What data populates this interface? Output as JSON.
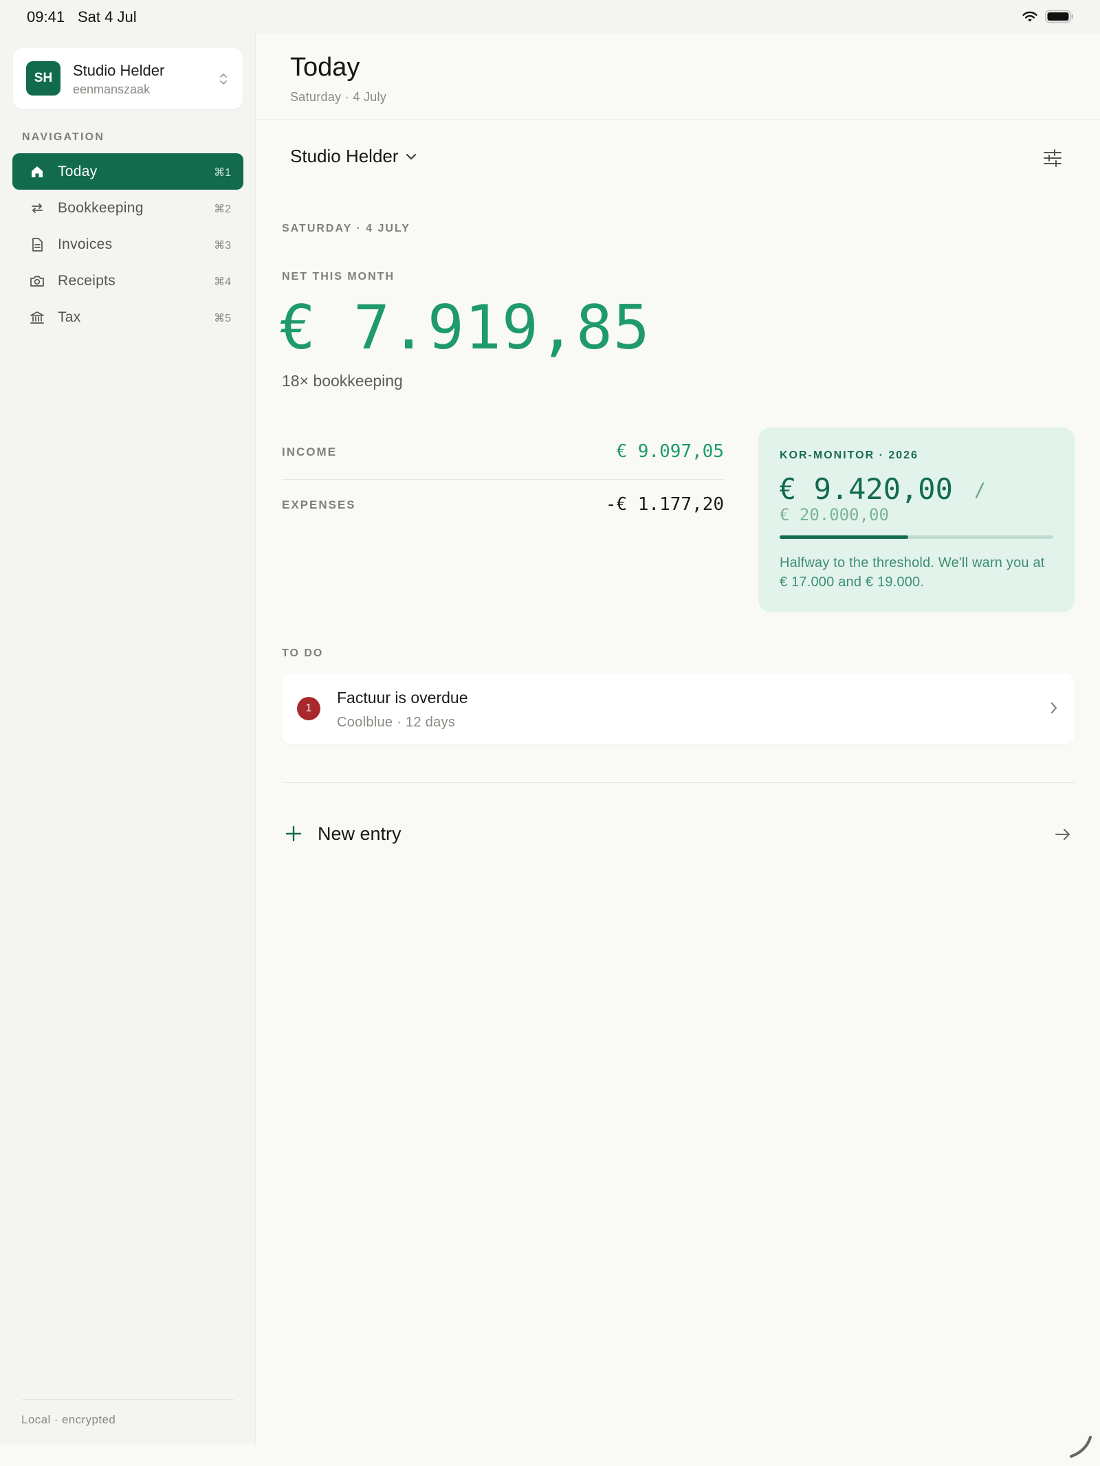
{
  "status_bar": {
    "time": "09:41",
    "date": "Sat 4 Jul"
  },
  "account": {
    "initials": "SH",
    "name": "Studio Helder",
    "type": "eenmanszaak"
  },
  "sidebar": {
    "heading": "NAVIGATION",
    "items": [
      {
        "label": "Today",
        "shortcut": "⌘1",
        "icon": "home-icon",
        "active": true
      },
      {
        "label": "Bookkeeping",
        "shortcut": "⌘2",
        "icon": "transfer-icon",
        "active": false
      },
      {
        "label": "Invoices",
        "shortcut": "⌘3",
        "icon": "document-icon",
        "active": false
      },
      {
        "label": "Receipts",
        "shortcut": "⌘4",
        "icon": "camera-icon",
        "active": false
      },
      {
        "label": "Tax",
        "shortcut": "⌘5",
        "icon": "bank-icon",
        "active": false
      }
    ],
    "footer": "Local · encrypted"
  },
  "header": {
    "title": "Today",
    "subtitle": "Saturday · 4 July"
  },
  "company_picker": {
    "label": "Studio Helder"
  },
  "summary": {
    "date_caption": "SATURDAY · 4 JULY",
    "net_caption": "NET THIS MONTH",
    "net_amount": "€ 7.919,85",
    "net_sub": "18× bookkeeping",
    "income_label": "INCOME",
    "income_value": "€ 9.097,05",
    "expenses_label": "EXPENSES",
    "expenses_value": "-€ 1.177,20"
  },
  "kor": {
    "title": "KOR-MONITOR · 2026",
    "amount": "€ 9.420,00",
    "separator": "/",
    "limit": "€ 20.000,00",
    "progress": 0.471,
    "note": "Halfway to the threshold. We'll warn you at € 17.000 and € 19.000."
  },
  "todo": {
    "heading": "TO DO",
    "items": [
      {
        "badge": "1",
        "title": "Factuur is overdue",
        "subtitle": "Coolblue · 12 days"
      }
    ]
  },
  "new_entry": {
    "label": "New entry"
  },
  "colors": {
    "accent": "#126b4d",
    "positive": "#1f9a6e",
    "kor_background": "#e2f3ec",
    "alert": "#a8282c"
  }
}
